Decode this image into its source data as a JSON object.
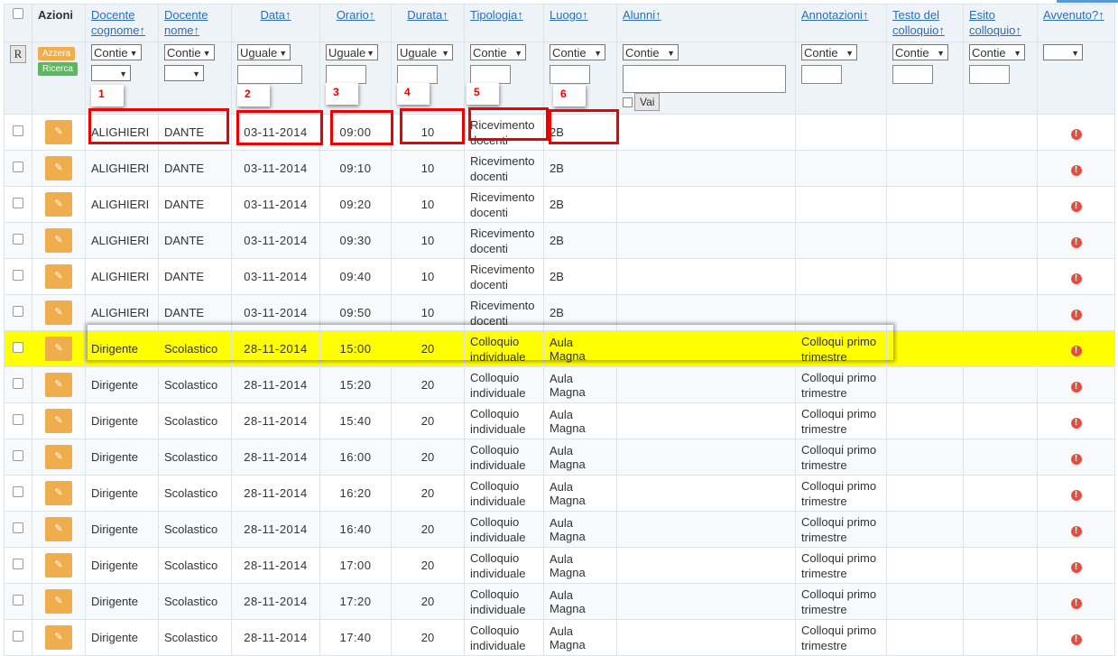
{
  "headers": {
    "azioni": "Azioni",
    "docente_cognome": [
      "Docente",
      "cognome↑"
    ],
    "docente_nome": [
      "Docente",
      "nome↑"
    ],
    "data": "Data↑",
    "orario": "Orario↑",
    "durata": "Durata↑",
    "tipologia": "Tipologia↑",
    "luogo": "Luogo↑",
    "alunni": "Alunni↑",
    "annotazioni": "Annotazioni↑",
    "testo": [
      "Testo del",
      "colloquio↑"
    ],
    "esito": [
      "Esito",
      "colloquio↑"
    ],
    "avvenuto": "Avvenuto?↑"
  },
  "filters": {
    "reset_label": "R",
    "azzera_label": "Azzera",
    "ricerca_label": "Ricerca",
    "contiene": "Contie",
    "uguale": "Uguale",
    "vai_label": "Vai"
  },
  "annotations": [
    "1",
    "2",
    "3",
    "4",
    "5",
    "6"
  ],
  "rows": [
    {
      "cognome": "ALIGHIERI",
      "nome": "DANTE",
      "data": "03-11-2014",
      "orario": "09:00",
      "durata": "10",
      "tipologia": [
        "Ricevimento",
        "docenti"
      ],
      "luogo": "2B",
      "annotazioni": [
        "",
        ""
      ]
    },
    {
      "cognome": "ALIGHIERI",
      "nome": "DANTE",
      "data": "03-11-2014",
      "orario": "09:10",
      "durata": "10",
      "tipologia": [
        "Ricevimento",
        "docenti"
      ],
      "luogo": "2B",
      "annotazioni": [
        "",
        ""
      ]
    },
    {
      "cognome": "ALIGHIERI",
      "nome": "DANTE",
      "data": "03-11-2014",
      "orario": "09:20",
      "durata": "10",
      "tipologia": [
        "Ricevimento",
        "docenti"
      ],
      "luogo": "2B",
      "annotazioni": [
        "",
        ""
      ]
    },
    {
      "cognome": "ALIGHIERI",
      "nome": "DANTE",
      "data": "03-11-2014",
      "orario": "09:30",
      "durata": "10",
      "tipologia": [
        "Ricevimento",
        "docenti"
      ],
      "luogo": "2B",
      "annotazioni": [
        "",
        ""
      ]
    },
    {
      "cognome": "ALIGHIERI",
      "nome": "DANTE",
      "data": "03-11-2014",
      "orario": "09:40",
      "durata": "10",
      "tipologia": [
        "Ricevimento",
        "docenti"
      ],
      "luogo": "2B",
      "annotazioni": [
        "",
        ""
      ]
    },
    {
      "cognome": "ALIGHIERI",
      "nome": "DANTE",
      "data": "03-11-2014",
      "orario": "09:50",
      "durata": "10",
      "tipologia": [
        "Ricevimento",
        "docenti"
      ],
      "luogo": "2B",
      "annotazioni": [
        "",
        ""
      ]
    },
    {
      "cognome": "Dirigente",
      "nome": "Scolastico",
      "data": "28-11-2014",
      "orario": "15:00",
      "durata": "20",
      "tipologia": [
        "Colloquio",
        "individuale"
      ],
      "luogo": "Aula Magna",
      "annotazioni": [
        "Colloqui primo",
        "trimestre"
      ]
    },
    {
      "cognome": "Dirigente",
      "nome": "Scolastico",
      "data": "28-11-2014",
      "orario": "15:20",
      "durata": "20",
      "tipologia": [
        "Colloquio",
        "individuale"
      ],
      "luogo": "Aula Magna",
      "annotazioni": [
        "Colloqui primo",
        "trimestre"
      ]
    },
    {
      "cognome": "Dirigente",
      "nome": "Scolastico",
      "data": "28-11-2014",
      "orario": "15:40",
      "durata": "20",
      "tipologia": [
        "Colloquio",
        "individuale"
      ],
      "luogo": "Aula Magna",
      "annotazioni": [
        "Colloqui primo",
        "trimestre"
      ]
    },
    {
      "cognome": "Dirigente",
      "nome": "Scolastico",
      "data": "28-11-2014",
      "orario": "16:00",
      "durata": "20",
      "tipologia": [
        "Colloquio",
        "individuale"
      ],
      "luogo": "Aula Magna",
      "annotazioni": [
        "Colloqui primo",
        "trimestre"
      ]
    },
    {
      "cognome": "Dirigente",
      "nome": "Scolastico",
      "data": "28-11-2014",
      "orario": "16:20",
      "durata": "20",
      "tipologia": [
        "Colloquio",
        "individuale"
      ],
      "luogo": "Aula Magna",
      "annotazioni": [
        "Colloqui primo",
        "trimestre"
      ]
    },
    {
      "cognome": "Dirigente",
      "nome": "Scolastico",
      "data": "28-11-2014",
      "orario": "16:40",
      "durata": "20",
      "tipologia": [
        "Colloquio",
        "individuale"
      ],
      "luogo": "Aula Magna",
      "annotazioni": [
        "Colloqui primo",
        "trimestre"
      ]
    },
    {
      "cognome": "Dirigente",
      "nome": "Scolastico",
      "data": "28-11-2014",
      "orario": "17:00",
      "durata": "20",
      "tipologia": [
        "Colloquio",
        "individuale"
      ],
      "luogo": "Aula Magna",
      "annotazioni": [
        "Colloqui primo",
        "trimestre"
      ]
    },
    {
      "cognome": "Dirigente",
      "nome": "Scolastico",
      "data": "28-11-2014",
      "orario": "17:20",
      "durata": "20",
      "tipologia": [
        "Colloquio",
        "individuale"
      ],
      "luogo": "Aula Magna",
      "annotazioni": [
        "Colloqui primo",
        "trimestre"
      ]
    },
    {
      "cognome": "Dirigente",
      "nome": "Scolastico",
      "data": "28-11-2014",
      "orario": "17:40",
      "durata": "20",
      "tipologia": [
        "Colloquio",
        "individuale"
      ],
      "luogo": "Aula Magna",
      "annotazioni": [
        "Colloqui primo",
        "trimestre"
      ]
    }
  ],
  "colors": {
    "highlight": "#ffff00",
    "annotation_red": "#e00000",
    "edit_orange": "#f0ad4e",
    "link_blue": "#2a6ebb"
  }
}
